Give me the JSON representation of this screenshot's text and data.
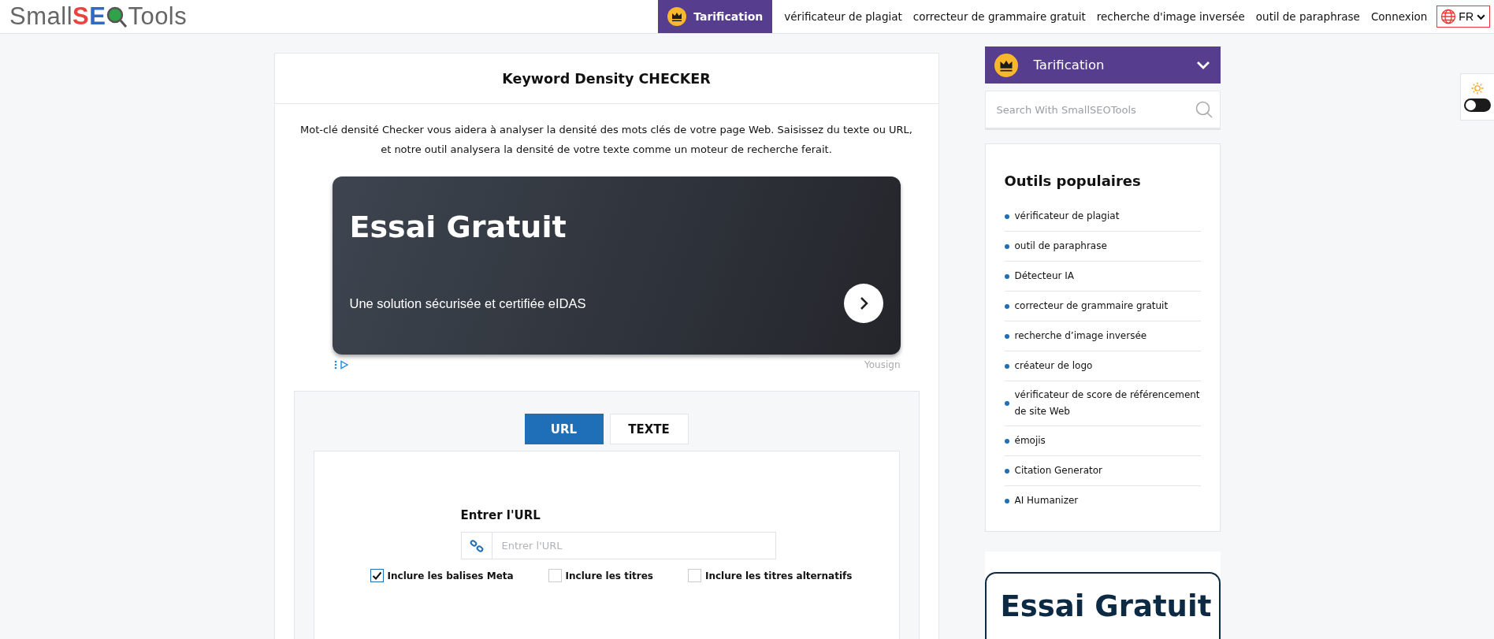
{
  "header": {
    "logo": {
      "part_1": "Small",
      "part_2": "S",
      "part_3": "E",
      "part_4": "Tools"
    },
    "pricing": "Tarification",
    "nav": [
      "vérificateur de plagiat",
      "correcteur de grammaire gratuit",
      "recherche d'image inversée",
      "outil de paraphrase",
      "Connexion"
    ],
    "language": "FR"
  },
  "main": {
    "title": "Keyword Density CHECKER",
    "intro": "Mot-clé densité Checker vous aidera à analyser la densité des mots clés de votre page Web. Saisissez du texte ou URL, et notre outil analysera la densité de votre texte comme un moteur de recherche ferait.",
    "ad": {
      "headline": "Essai Gratuit",
      "text": "Une solution sécurisée et certifiée eIDAS",
      "advertiser": "Yousign"
    },
    "tool": {
      "tabs": [
        {
          "label": "URL",
          "selected": true
        },
        {
          "label": "TEXTE",
          "selected": false
        }
      ],
      "field_label": "Entrer l'URL",
      "url_field": {
        "placeholder": "Entrer l'URL"
      },
      "options": [
        {
          "label": "Inclure les balises Meta",
          "checked": true
        },
        {
          "label": "Inclure les titres",
          "checked": false
        },
        {
          "label": "Inclure les titres alternatifs",
          "checked": false
        }
      ]
    }
  },
  "sidebar": {
    "pricing": {
      "label": "Tarification",
      "expanded": false
    },
    "search": {
      "placeholder": "Search With SmallSEOTools"
    },
    "popular": {
      "title": "Outils populaires",
      "items": [
        "vérificateur de plagiat",
        "outil de paraphrase",
        "Détecteur IA",
        "correcteur de grammaire gratuit",
        "recherche d’image inversée",
        "créateur de logo",
        "vérificateur de score de référencement de site Web",
        "émojis",
        "Citation Generator",
        "AI Humanizer"
      ]
    },
    "ad": {
      "headline": "Essai Gratuit"
    }
  },
  "theme_toggle": {
    "on": false
  }
}
